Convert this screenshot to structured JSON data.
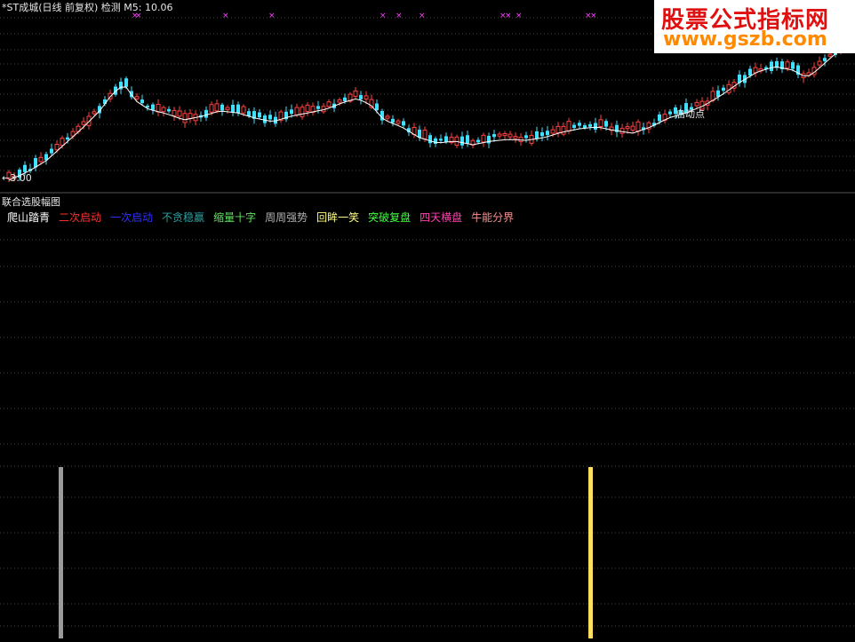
{
  "main_chart": {
    "title": "*ST成城(日线 前复权) 检测",
    "ma_label": "M5: 10.06",
    "start_point_label": "启动点",
    "price_marker_label": "←3.00"
  },
  "sub_chart": {
    "title": "联合选股幅图",
    "legend": [
      {
        "label": "爬山踏青",
        "color": "#ffffff"
      },
      {
        "label": "二次启动",
        "color": "#ff3030"
      },
      {
        "label": "一次启动",
        "color": "#3030ff"
      },
      {
        "label": "不贪稳赢",
        "color": "#2aa0a0"
      },
      {
        "label": "缩量十字",
        "color": "#60e060"
      },
      {
        "label": "周周强势",
        "color": "#b0b0b0"
      },
      {
        "label": "回眸一笑",
        "color": "#ffff80"
      },
      {
        "label": "突破复盘",
        "color": "#40ff40"
      },
      {
        "label": "四天横盘",
        "color": "#ff40b0"
      },
      {
        "label": "牛能分界",
        "color": "#ff9090"
      }
    ],
    "signal_bars": [
      {
        "name": "gray-signal",
        "color": "#9a9a9a"
      },
      {
        "name": "yellow-signal",
        "color": "#ffe060"
      }
    ]
  },
  "watermark": {
    "line1": "股票公式指标网",
    "line2": "www.gszb.com"
  },
  "colors": {
    "up": "#ff4040",
    "down": "#40e0ff",
    "ma": "#ffffff",
    "marker": "#ff40ff",
    "grid": "#444444"
  }
}
